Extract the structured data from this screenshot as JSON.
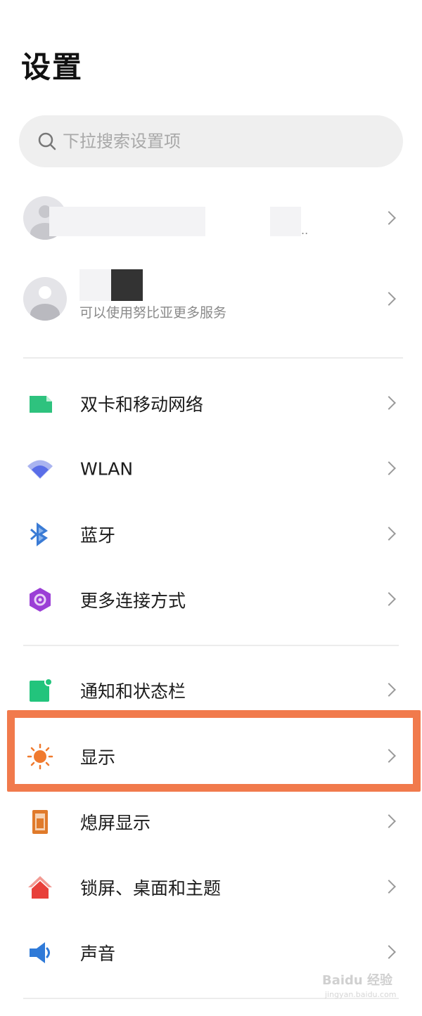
{
  "header": {
    "title": "设置"
  },
  "search": {
    "placeholder": "下拉搜索设置项"
  },
  "accounts": [
    {
      "subtitle": "..",
      "name": ""
    },
    {
      "subtitle": "可以使用努比亚更多服务"
    }
  ],
  "groups": [
    {
      "items": [
        {
          "label": "双卡和移动网络",
          "icon": "sim-card-icon"
        },
        {
          "label": "WLAN",
          "icon": "wifi-icon"
        },
        {
          "label": "蓝牙",
          "icon": "bluetooth-icon"
        },
        {
          "label": "更多连接方式",
          "icon": "connection-icon"
        }
      ]
    },
    {
      "items": [
        {
          "label": "通知和状态栏",
          "icon": "notification-icon"
        },
        {
          "label": "显示",
          "icon": "brightness-icon",
          "highlighted": true
        },
        {
          "label": "熄屏显示",
          "icon": "aod-icon"
        },
        {
          "label": "锁屏、桌面和主题",
          "icon": "home-theme-icon"
        },
        {
          "label": "声音",
          "icon": "speaker-icon"
        }
      ]
    }
  ],
  "watermark": {
    "text": "Baidu 经验",
    "sub": "jingyan.baidu.com"
  },
  "colors": {
    "highlight": "#f17a4c",
    "sim": "#2ec27e",
    "wifi": "#5a6ee8",
    "bluetooth": "#3a7bd5",
    "connection": "#9b3fd6",
    "notification": "#22c47c",
    "display": "#f07a2e",
    "aod": "#e07a2a",
    "theme": "#e8403a",
    "speaker": "#2f7ad8"
  }
}
